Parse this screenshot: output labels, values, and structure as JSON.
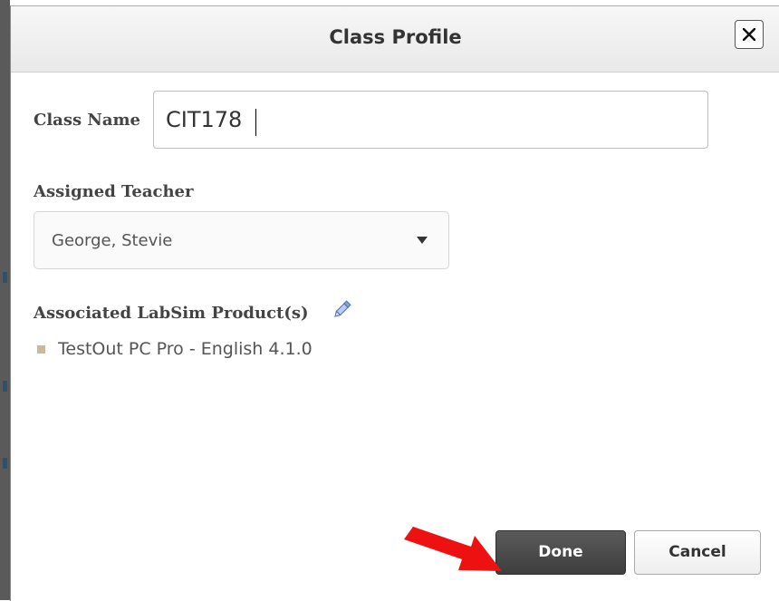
{
  "dialog": {
    "title": "Class Profile",
    "close_label": "×"
  },
  "form": {
    "class_name_label": "Class Name",
    "class_name_value": "CIT178",
    "teacher_label": "Assigned Teacher",
    "teacher_selected": "George, Stevie",
    "products_label": "Associated LabSim Product(s)",
    "products": [
      "TestOut PC Pro - English 4.1.0"
    ]
  },
  "buttons": {
    "done": "Done",
    "cancel": "Cancel"
  },
  "annotation": {
    "arrow_color": "#ee1111",
    "arrow_target": "done-button"
  },
  "icons": {
    "close": "close-icon",
    "edit": "pencil-icon",
    "dropdown": "chevron-down-icon"
  },
  "colors": {
    "done_bg": "#4a4a4a",
    "bullet": "#c8bb98"
  }
}
